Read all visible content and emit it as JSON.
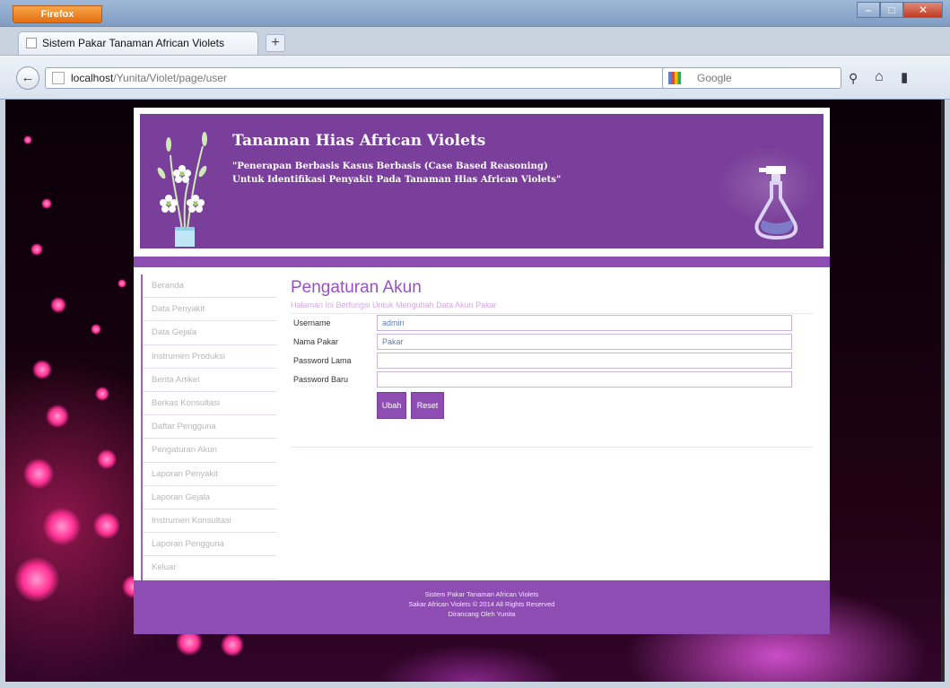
{
  "browser": {
    "menu_label": "Firefox",
    "tab_title": "Sistem Pakar Tanaman African Violets",
    "url_host": "localhost",
    "url_path": "/Yunita/Violet/page/user",
    "search_placeholder": "Google",
    "window_controls": [
      "–",
      "□",
      "✕"
    ]
  },
  "header": {
    "title": "Tanaman Hias African Violets",
    "subtitle_line1": "\"Penerapan Berbasis Kasus Berbasis (Case Based Reasoning)",
    "subtitle_line2": "Untuk Identifikasi Penyakit Pada Tanaman Hias African Violets\""
  },
  "sidebar": {
    "items": [
      "Beranda",
      "Data Penyakit",
      "Data Gejala",
      "Instrumen Produksi",
      "Berita Artikel",
      "Berkas Konsultasi",
      "Daftar Pengguna",
      "Pengaturan Akun",
      "Laporan Penyakit",
      "Laporan Gejala",
      "Instrumen Konsultasi",
      "Laporan Pengguna",
      "Keluar"
    ]
  },
  "main": {
    "title": "Pengaturan Akun",
    "subtitle": "Halaman Ini Berfungsi Untuk Mengubah Data Akun Pakar",
    "form": {
      "username_label": "Username",
      "username_value": "admin",
      "nama_label": "Nama Pakar",
      "nama_value": "Pakar",
      "password_lama_label": "Password Lama",
      "password_lama_value": "",
      "password_baru_label": "Password Baru",
      "password_baru_value": "",
      "submit_label": "Ubah",
      "reset_label": "Reset"
    }
  },
  "footer": {
    "line1": "Sistem Pakar Tanaman African Violets",
    "line2": "Sakar African Violets © 2014 All Rights Reserved",
    "line3": "Dirancang Oleh Yunita"
  },
  "colors": {
    "brand_purple": "#8e4db2",
    "banner_purple": "#7a3f9a",
    "title_purple": "#9b4fc5"
  }
}
